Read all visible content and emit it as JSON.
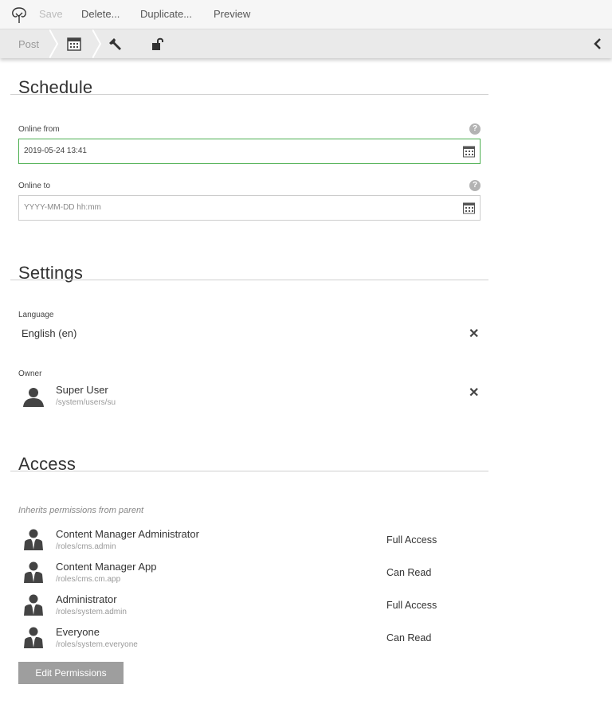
{
  "toolbar": {
    "save": "Save",
    "delete": "Delete...",
    "duplicate": "Duplicate...",
    "preview": "Preview"
  },
  "tabs": {
    "post": "Post",
    "icons": [
      "calendar-icon",
      "wrench-icon",
      "unlock-icon"
    ]
  },
  "schedule": {
    "title": "Schedule",
    "online_from_label": "Online from",
    "online_from_value": "2019-05-24 13:41",
    "online_to_label": "Online to",
    "online_to_placeholder": "YYYY-MM-DD hh:mm",
    "help": "?"
  },
  "settings": {
    "title": "Settings",
    "language_label": "Language",
    "language_value": "English (en)",
    "owner_label": "Owner",
    "owner_name": "Super User",
    "owner_path": "/system/users/su",
    "remove": "✕"
  },
  "access": {
    "title": "Access",
    "note": "Inherits permissions from parent",
    "roles": [
      {
        "name": "Content Manager Administrator",
        "path": "/roles/cms.admin",
        "level": "Full Access"
      },
      {
        "name": "Content Manager App",
        "path": "/roles/cms.cm.app",
        "level": "Can Read"
      },
      {
        "name": "Administrator",
        "path": "/roles/system.admin",
        "level": "Full Access"
      },
      {
        "name": "Everyone",
        "path": "/roles/system.everyone",
        "level": "Can Read"
      }
    ],
    "edit_button": "Edit Permissions"
  },
  "colors": {
    "active_border": "#4caf50",
    "button_bg": "#9e9e9e",
    "toolbar_bg": "#f6f6f6"
  }
}
